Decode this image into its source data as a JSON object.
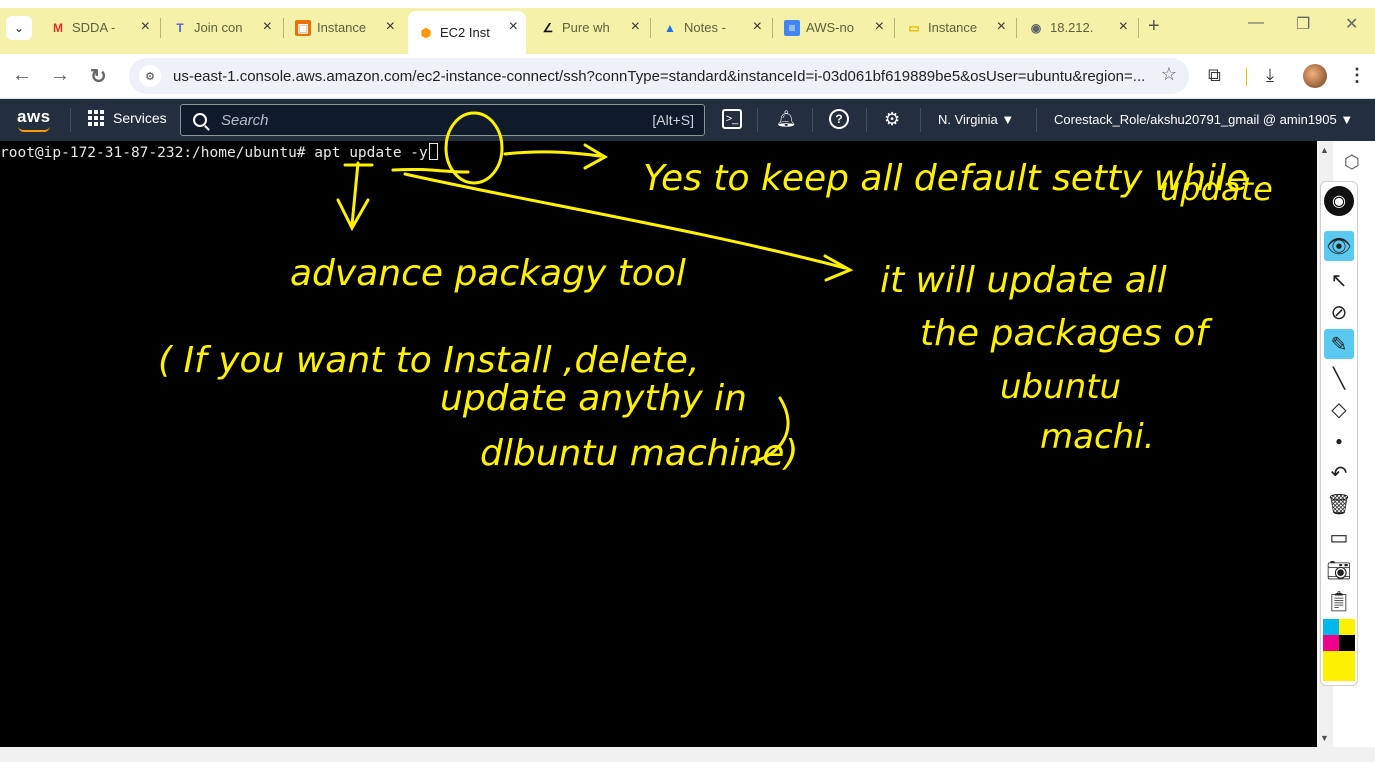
{
  "browser": {
    "tabs": [
      {
        "title": "SDDA -",
        "icon": "gmail-icon",
        "color": "#d93025",
        "glyph": "M"
      },
      {
        "title": "Join con",
        "icon": "teams-icon",
        "color": "#5b5fc7",
        "glyph": "T"
      },
      {
        "title": "Instance",
        "icon": "aws-orange-icon",
        "color": "#e8710a",
        "glyph": "▣"
      },
      {
        "title": "EC2 Inst",
        "icon": "ec2-icon",
        "color": "#ff9900",
        "glyph": "⬢"
      },
      {
        "title": "Pure wh",
        "icon": "linear-icon",
        "color": "#111111",
        "glyph": "∠"
      },
      {
        "title": "Notes -",
        "icon": "drive-icon",
        "color": "#1a73e8",
        "glyph": "▲"
      },
      {
        "title": "AWS-no",
        "icon": "docs-icon",
        "color": "#4285f4",
        "glyph": "≡"
      },
      {
        "title": "Instance",
        "icon": "slides-icon",
        "color": "#f4b400",
        "glyph": "▭"
      },
      {
        "title": "18.212.",
        "icon": "globe-icon",
        "color": "#5f6368",
        "glyph": "◉"
      }
    ],
    "active_tab": 3,
    "url": "us-east-1.console.aws.amazon.com/ec2-instance-connect/ssh?connType=standard&instanceId=i-03d061bf619889be5&osUser=ubuntu&region=..."
  },
  "aws": {
    "logo": "aws",
    "services_label": "Services",
    "search_placeholder": "Search",
    "search_shortcut": "[Alt+S]",
    "region": "N. Virginia ▼",
    "account": "Corestack_Role/akshu20791_gmail @ amin1905 ▼"
  },
  "terminal": {
    "prompt": "root@ip-172-31-87-232:/home/ubuntu# ",
    "command": "apt update -y"
  },
  "annotations": {
    "yes_note": "Yes to keep all default setty while",
    "yes_note2": "update",
    "apt_note": "advance packagy tool",
    "paren_line1": "( If you want to Install ,delete,",
    "paren_line2": "update anythy in",
    "paren_line3": "dlbuntu machine)",
    "right_line1": "it will update all",
    "right_line2": "the packages of",
    "right_line3": "ubuntu",
    "right_line4": "machi."
  },
  "colors": {
    "tabstrip": "#f5f1a9",
    "aws_bar": "#232f3e",
    "ink": "#fff200",
    "highlight": "#5bc8f0"
  }
}
